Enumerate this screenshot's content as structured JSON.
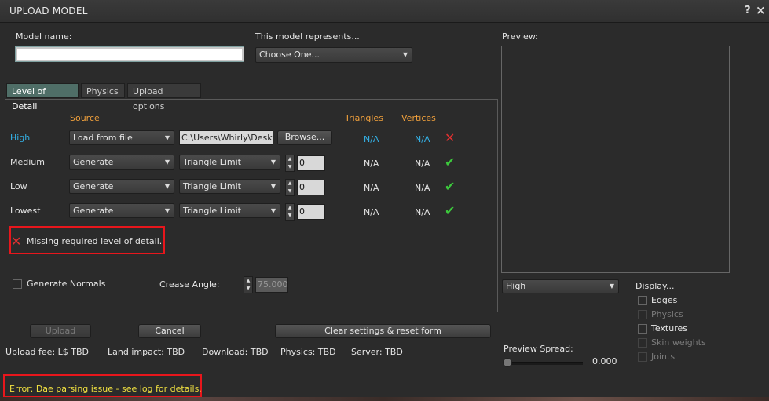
{
  "window": {
    "title": "UPLOAD MODEL",
    "help": "?",
    "close": "×"
  },
  "model_name": {
    "label": "Model name:",
    "value": ""
  },
  "represents": {
    "label": "This model represents...",
    "value": "Choose One..."
  },
  "tabs": [
    "Level of Detail",
    "Physics",
    "Upload options"
  ],
  "lod": {
    "headers": {
      "source": "Source",
      "triangles": "Triangles",
      "vertices": "Vertices"
    },
    "rows": [
      {
        "label": "High",
        "source": "Load from file",
        "path": "C:\\Users\\Whirly\\Deskto",
        "browse": "Browse...",
        "triangles": "N/A",
        "vertices": "N/A",
        "status": "error"
      },
      {
        "label": "Medium",
        "source": "Generate",
        "method": "Triangle Limit",
        "value": "0",
        "triangles": "N/A",
        "vertices": "N/A",
        "status": "ok"
      },
      {
        "label": "Low",
        "source": "Generate",
        "method": "Triangle Limit",
        "value": "0",
        "triangles": "N/A",
        "vertices": "N/A",
        "status": "ok"
      },
      {
        "label": "Lowest",
        "source": "Generate",
        "method": "Triangle Limit",
        "value": "0",
        "triangles": "N/A",
        "vertices": "N/A",
        "status": "ok"
      }
    ],
    "missing_message": "Missing required level of detail.",
    "generate_normals": "Generate Normals",
    "crease_angle_label": "Crease Angle:",
    "crease_angle_value": "75.000"
  },
  "buttons": {
    "upload": "Upload",
    "cancel": "Cancel",
    "clear": "Clear settings & reset form"
  },
  "stats": {
    "upload_fee": "Upload fee: L$ TBD",
    "land_impact": "Land impact: TBD",
    "download": "Download: TBD",
    "physics": "Physics: TBD",
    "server": "Server: TBD"
  },
  "error": "Error: Dae parsing issue - see log for details.",
  "preview": {
    "label": "Preview:",
    "lod_select": "High",
    "display_label": "Display...",
    "options": [
      {
        "label": "Edges",
        "enabled": true
      },
      {
        "label": "Physics",
        "enabled": false
      },
      {
        "label": "Textures",
        "enabled": true
      },
      {
        "label": "Skin weights",
        "enabled": false
      },
      {
        "label": "Joints",
        "enabled": false
      }
    ],
    "spread_label": "Preview Spread:",
    "spread_value": "0.000"
  },
  "colors": {
    "accent_tab": "#4f6e67",
    "header": "#f0a03c",
    "highlight": "#34b4ea",
    "error_box": "#e8161c",
    "error_text": "#f0e040"
  }
}
